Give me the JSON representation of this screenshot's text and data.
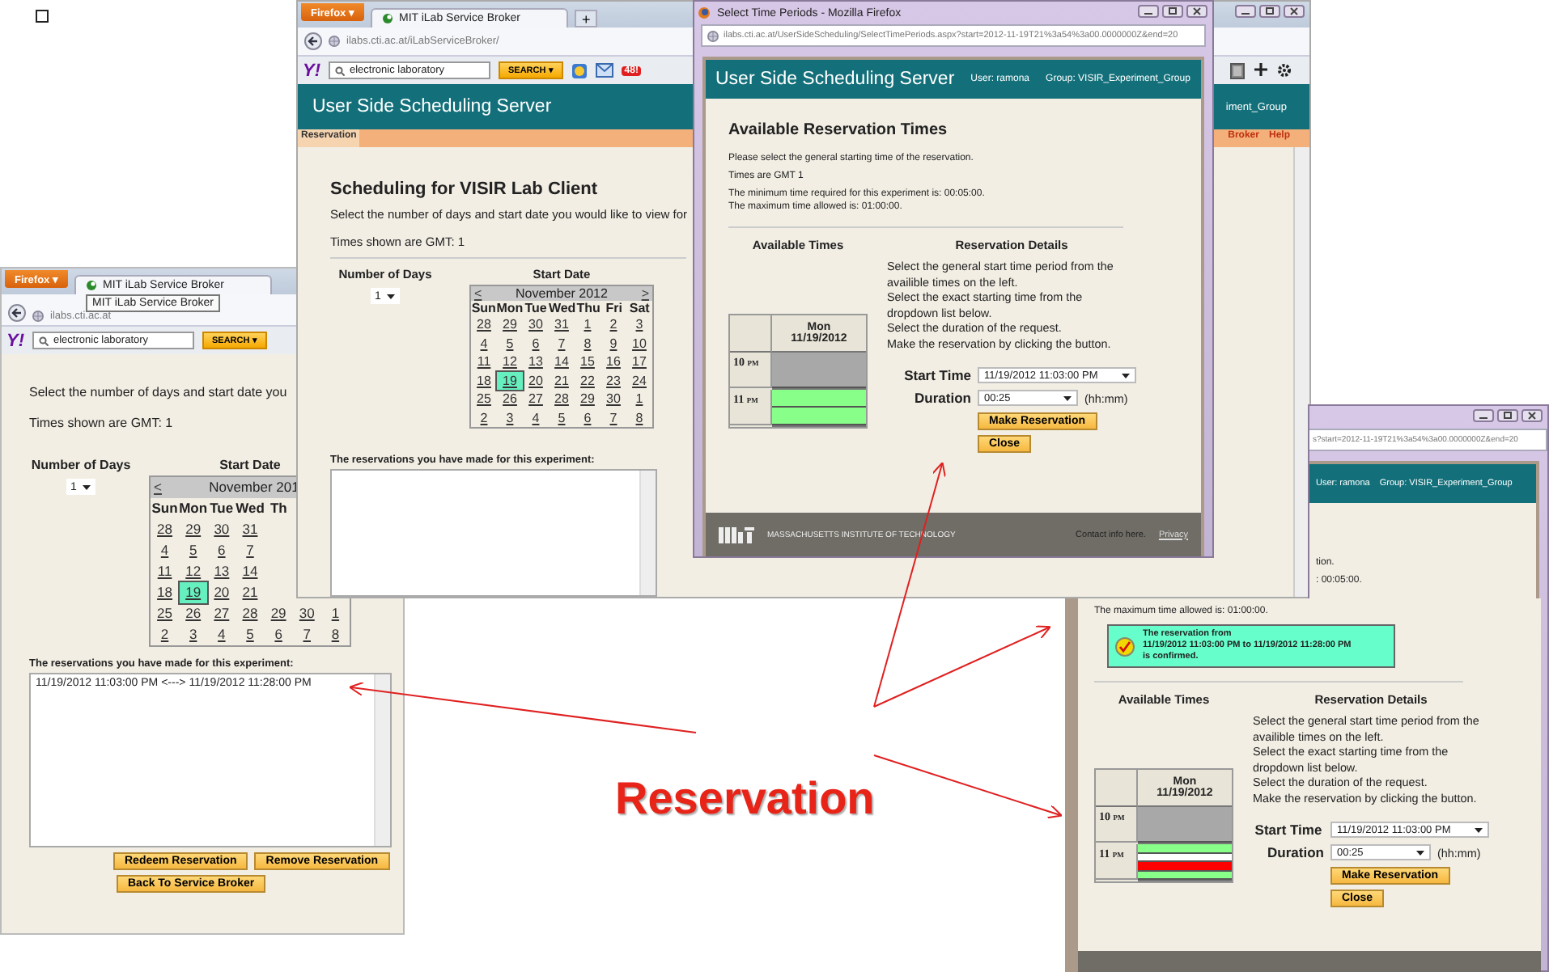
{
  "corner_checkbox": {
    "checked": false
  },
  "back_window": {
    "firefox_button": "Firefox ▾",
    "tab": "MIT iLab Service Broker",
    "tooltip": "MIT iLab Service Broker",
    "url": "ilabs.cti.ac.at",
    "toolbar_logo": "Y!",
    "search": {
      "value": "electronic laboratory",
      "button": "SEARCH ▾"
    },
    "intro": "Select the number of days and start date you",
    "timezone": "Times shown are GMT:  1",
    "days_label": "Number of Days",
    "days_value": "1",
    "start_label": "Start Date",
    "calendar": {
      "prev": "<",
      "month": "November 201",
      "weekdays": [
        "Sun",
        "Mon",
        "Tue",
        "Wed",
        "Th"
      ],
      "weeks": [
        [
          {
            "label": "28",
            "selected": false
          },
          {
            "label": "29",
            "selected": false
          },
          {
            "label": "30",
            "selected": false
          },
          {
            "label": "31",
            "selected": false
          }
        ],
        [
          {
            "label": "4",
            "selected": false
          },
          {
            "label": "5",
            "selected": false
          },
          {
            "label": "6",
            "selected": false
          },
          {
            "label": "7",
            "selected": false
          }
        ],
        [
          {
            "label": "11",
            "selected": false
          },
          {
            "label": "12",
            "selected": false
          },
          {
            "label": "13",
            "selected": false
          },
          {
            "label": "14",
            "selected": false
          }
        ],
        [
          {
            "label": "18",
            "selected": false
          },
          {
            "label": "19",
            "selected": true
          },
          {
            "label": "20",
            "selected": false
          },
          {
            "label": "21",
            "selected": false
          }
        ],
        [
          {
            "label": "25",
            "selected": false
          },
          {
            "label": "26",
            "selected": false
          },
          {
            "label": "27",
            "selected": false
          },
          {
            "label": "28",
            "selected": false
          },
          {
            "label": "29",
            "selected": false
          },
          {
            "label": "30",
            "selected": false
          },
          {
            "label": "1",
            "selected": false
          }
        ],
        [
          {
            "label": "2",
            "selected": false
          },
          {
            "label": "3",
            "selected": false
          },
          {
            "label": "4",
            "selected": false
          },
          {
            "label": "5",
            "selected": false
          },
          {
            "label": "6",
            "selected": false
          },
          {
            "label": "7",
            "selected": false
          },
          {
            "label": "8",
            "selected": false
          }
        ]
      ]
    },
    "reservations_label": "The reservations you have made for this experiment:",
    "reservations": [
      "11/19/2012 11:03:00 PM <---> 11/19/2012 11:28:00 PM"
    ],
    "buttons": [
      "Redeem Reservation",
      "Remove Reservation",
      "Back To Service Broker"
    ]
  },
  "front_window": {
    "firefox_button": "Firefox ▾",
    "tab": "MIT iLab Service Broker",
    "new_tab": "+",
    "url": "ilabs.cti.ac.at/iLabServiceBroker/",
    "toolbar_logo": "Y!",
    "search": {
      "value": "electronic laboratory",
      "button": "SEARCH ▾"
    },
    "mail_badge": "48!",
    "header": {
      "title": "User Side Scheduling Server",
      "group_fragment": "iment_Group"
    },
    "nav_left": [
      {
        "label": "Reservation",
        "selected": true
      }
    ],
    "nav_right": [
      {
        "label": "Broker",
        "selected": false
      },
      {
        "label": "Help",
        "selected": false
      }
    ],
    "heading": "Scheduling for VISIR Lab Client",
    "intro": "Select the number of days and start date you would like to view for",
    "timezone": "Times shown are GMT:  1",
    "days_label": "Number of Days",
    "days_value": "1",
    "start_label": "Start Date",
    "calendar": {
      "prev": "<",
      "month": "November 2012",
      "next": ">",
      "weekdays": [
        "Sun",
        "Mon",
        "Tue",
        "Wed",
        "Thu",
        "Fri",
        "Sat"
      ],
      "weeks": [
        [
          {
            "label": "28",
            "selected": false
          },
          {
            "label": "29",
            "selected": false
          },
          {
            "label": "30",
            "selected": false
          },
          {
            "label": "31",
            "selected": false
          },
          {
            "label": "1",
            "selected": false
          },
          {
            "label": "2",
            "selected": false
          },
          {
            "label": "3",
            "selected": false
          }
        ],
        [
          {
            "label": "4",
            "selected": false
          },
          {
            "label": "5",
            "selected": false
          },
          {
            "label": "6",
            "selected": false
          },
          {
            "label": "7",
            "selected": false
          },
          {
            "label": "8",
            "selected": false
          },
          {
            "label": "9",
            "selected": false
          },
          {
            "label": "10",
            "selected": false
          }
        ],
        [
          {
            "label": "11",
            "selected": false
          },
          {
            "label": "12",
            "selected": false
          },
          {
            "label": "13",
            "selected": false
          },
          {
            "label": "14",
            "selected": false
          },
          {
            "label": "15",
            "selected": false
          },
          {
            "label": "16",
            "selected": false
          },
          {
            "label": "17",
            "selected": false
          }
        ],
        [
          {
            "label": "18",
            "selected": false
          },
          {
            "label": "19",
            "selected": true
          },
          {
            "label": "20",
            "selected": false
          },
          {
            "label": "21",
            "selected": false
          },
          {
            "label": "22",
            "selected": false
          },
          {
            "label": "23",
            "selected": false
          },
          {
            "label": "24",
            "selected": false
          }
        ],
        [
          {
            "label": "25",
            "selected": false
          },
          {
            "label": "26",
            "selected": false
          },
          {
            "label": "27",
            "selected": false
          },
          {
            "label": "28",
            "selected": false
          },
          {
            "label": "29",
            "selected": false
          },
          {
            "label": "30",
            "selected": false
          },
          {
            "label": "1",
            "selected": false
          }
        ],
        [
          {
            "label": "2",
            "selected": false
          },
          {
            "label": "3",
            "selected": false
          },
          {
            "label": "4",
            "selected": false
          },
          {
            "label": "5",
            "selected": false
          },
          {
            "label": "6",
            "selected": false
          },
          {
            "label": "7",
            "selected": false
          },
          {
            "label": "8",
            "selected": false
          }
        ]
      ]
    },
    "reservations_label": "The reservations you have made for this experiment:"
  },
  "popup": {
    "title": "Select Time Periods - Mozilla Firefox",
    "url": "ilabs.cti.ac.at/UserSideScheduling/SelectTimePeriods.aspx?start=2012-11-19T21%3a54%3a00.0000000Z&end=20",
    "header": {
      "title": "User Side Scheduling Server",
      "user": "User: ramona",
      "group": "Group: VISIR_Experiment_Group"
    },
    "heading": "Available Reservation Times",
    "notes": [
      "Please select the general starting time of the reservation.",
      "Times are GMT 1"
    ],
    "limits": [
      "The minimum time required for this experiment is: 00:05:00.",
      "The maximum time allowed is: 01:00:00."
    ],
    "available_heading": "Available Times",
    "details_heading": "Reservation Details",
    "instructions": [
      "Select the general start time period from the availible times on the left.",
      "Select the exact starting time from the dropdown list below.",
      "Select the duration of the request.",
      "Make the reservation by clicking the button."
    ],
    "grid": {
      "day": "Mon",
      "date": "11/19/2012",
      "hours": [
        {
          "hour": "10",
          "suffix": "PM",
          "blocks": [
            {
              "kind": "unavailable"
            }
          ]
        },
        {
          "hour": "11",
          "suffix": "PM",
          "blocks": [
            {
              "kind": "available"
            },
            {
              "kind": "available"
            }
          ]
        }
      ]
    },
    "start_time": {
      "label": "Start Time",
      "value": "11/19/2012 11:03:00 PM"
    },
    "duration": {
      "label": "Duration",
      "value": "00:25",
      "unit": "(hh:mm)"
    },
    "buttons": [
      "Make Reservation",
      "Close"
    ],
    "footer": {
      "org": "MASSACHUSETTS INSTITUTE OF TECHNOLOGY",
      "contact": "Contact info here.",
      "link": "Privacy"
    }
  },
  "right_window": {
    "url": "s?start=2012-11-19T21%3a54%3a00.0000000Z&end=20",
    "user": "User: ramona",
    "group": "Group: VISIR_Experiment_Group",
    "fragments": [
      "tion.",
      ": 00:05:00."
    ]
  },
  "confirmed_panel": {
    "limit": "The maximum time allowed is: 01:00:00.",
    "confirmation": [
      "The reservation from",
      "11/19/2012 11:03:00 PM to 11/19/2012 11:28:00 PM",
      "is confirmed."
    ],
    "available_heading": "Available Times",
    "details_heading": "Reservation Details",
    "instructions": [
      "Select the general start time period from the availible times on the left.",
      "Select the exact starting time from the dropdown list below.",
      "Select the duration of the request.",
      "Make the reservation by clicking the button."
    ],
    "grid": {
      "day": "Mon",
      "date": "11/19/2012",
      "hours": [
        {
          "hour": "10",
          "suffix": "PM",
          "blocks": [
            {
              "kind": "unavailable"
            }
          ]
        },
        {
          "hour": "11",
          "suffix": "PM",
          "blocks": [
            {
              "kind": "available"
            },
            {
              "kind": "empty"
            },
            {
              "kind": "reserved"
            },
            {
              "kind": "available"
            }
          ]
        }
      ]
    },
    "start_time": {
      "label": "Start Time",
      "value": "11/19/2012 11:03:00 PM"
    },
    "duration": {
      "label": "Duration",
      "value": "00:25",
      "unit": "(hh:mm)"
    },
    "buttons": [
      "Make Reservation",
      "Close"
    ]
  },
  "annotation": {
    "label": "Reservation"
  }
}
